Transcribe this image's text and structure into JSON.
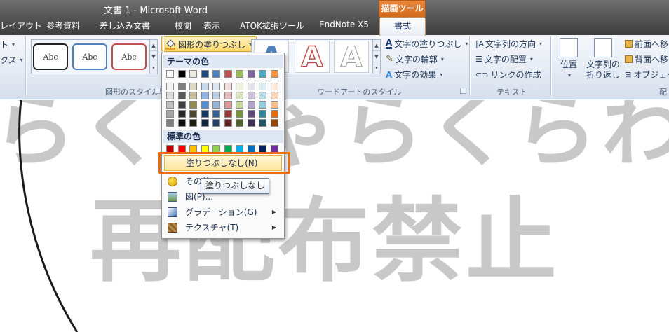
{
  "window": {
    "title": "文書 1 - Microsoft Word"
  },
  "contextual_tab_group": "描画ツール",
  "tabs": [
    {
      "label": "レイアウト"
    },
    {
      "label": "参考資料"
    },
    {
      "label": "差し込み文書"
    },
    {
      "label": "校閲"
    },
    {
      "label": "表示"
    },
    {
      "label": "ATOK拡張ツール"
    },
    {
      "label": "EndNote X5"
    }
  ],
  "active_tab": "書式",
  "ribbon": {
    "left_edge": {
      "item1_label": "ト",
      "item2_label": "クス"
    },
    "shape_styles": {
      "group_label": "図形のスタイル",
      "thumbnails": [
        "Abc",
        "Abc",
        "Abc"
      ],
      "fill_button_label": "図形の塗りつぶし"
    },
    "wordart": {
      "group_label": "ワードアートのスタイル",
      "thumb_letter": "A",
      "text_fill": "文字の塗りつぶし",
      "text_outline": "文字の輪郭",
      "text_effects": "文字の効果"
    },
    "text": {
      "group_label": "テキスト",
      "direction": "文字列の方向",
      "align": "文字の配置",
      "link": "リンクの作成"
    },
    "arrange": {
      "position_label": "位置",
      "wrap_label_1": "文字列の",
      "wrap_label_2": "折り返し",
      "bring_forward": "前面へ移",
      "send_backward": "背面へ移",
      "object": "オブジェク",
      "group_label_partial": "配"
    }
  },
  "fill_dropdown": {
    "theme_colors_header": "テーマの色",
    "standard_colors_header": "標準の色",
    "theme_top_row": [
      "#ffffff",
      "#000000",
      "#eeece1",
      "#1f497d",
      "#4f81bd",
      "#c0504d",
      "#9bbb59",
      "#8064a2",
      "#4bacc6",
      "#f79646"
    ],
    "theme_shades": [
      [
        "#f2f2f2",
        "#d8d8d8",
        "#bfbfbf",
        "#a5a5a5",
        "#7f7f7f"
      ],
      [
        "#7f7f7f",
        "#595959",
        "#3f3f3f",
        "#262626",
        "#0c0c0c"
      ],
      [
        "#ddd9c3",
        "#c4bd97",
        "#938953",
        "#494429",
        "#1d1b10"
      ],
      [
        "#c6d9f0",
        "#8db3e2",
        "#548dd4",
        "#17365d",
        "#0f243e"
      ],
      [
        "#dbe5f1",
        "#b8cce4",
        "#95b3d7",
        "#366092",
        "#244061"
      ],
      [
        "#f2dcdb",
        "#e5b9b7",
        "#d99694",
        "#953734",
        "#632423"
      ],
      [
        "#ebf1dd",
        "#d7e3bc",
        "#c3d69b",
        "#76923c",
        "#4f6128"
      ],
      [
        "#e5e0ec",
        "#ccc1d9",
        "#b2a2c7",
        "#5f497a",
        "#3f3151"
      ],
      [
        "#dbeef3",
        "#b7dde8",
        "#92cddc",
        "#31859b",
        "#205867"
      ],
      [
        "#fdeada",
        "#fbd5b5",
        "#fac08f",
        "#e36c09",
        "#974806"
      ]
    ],
    "standard_colors": [
      "#c00000",
      "#ff0000",
      "#ffc000",
      "#ffff00",
      "#92d050",
      "#00b050",
      "#00b0f0",
      "#0070c0",
      "#002060",
      "#7030a0"
    ],
    "no_fill": "塗りつぶしなし(N)",
    "more_colors": "その他",
    "picture": "図(P)...",
    "gradient": "グラデーション(G)",
    "texture": "テクスチャ(T)"
  },
  "tooltip": "塗りつぶしなし",
  "document": {
    "watermark_top": "らくちゃらくらわお.c",
    "watermark_main": "再配布禁止"
  }
}
